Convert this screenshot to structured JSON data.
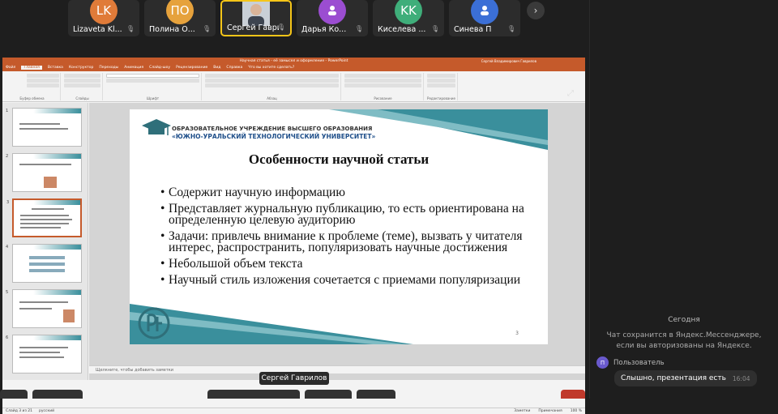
{
  "participants": [
    {
      "initials": "LK",
      "name": "Lizaveta Kl...",
      "color": "#e07b39"
    },
    {
      "initials": "ПО",
      "name": "Полина О...",
      "color": "#e6a23c"
    },
    {
      "initials": "",
      "name": "Сергей Гаври...",
      "color": "#8899aa",
      "active": true
    },
    {
      "initials": "",
      "name": "Дарья Ко...",
      "color": "#9b4dd1"
    },
    {
      "initials": "KK",
      "name": "Киселева ...",
      "color": "#3fae7a"
    },
    {
      "initials": "",
      "name": "Синева П",
      "color": "#3b6fd6"
    }
  ],
  "ppt": {
    "window_title": "Научная статья - её замысел и оформление - PowerPoint",
    "user_name": "Сергей Владимирович Гаврилов",
    "menu": [
      "Файл",
      "Главная",
      "Вставка",
      "Конструктор",
      "Переходы",
      "Анимация",
      "Слайд-шоу",
      "Рецензирование",
      "Вид",
      "Справка",
      "Что вы хотите сделать?"
    ],
    "selected_menu": "Главная",
    "ribbon_groups": [
      "Буфер обмена",
      "Слайды",
      "Шрифт",
      "Абзац",
      "Рисование",
      "Редактирование"
    ],
    "notes_placeholder": "Щелкните, чтобы добавить заметки",
    "status_left": "Слайд 3 из 21",
    "status_lang": "русский",
    "status_notes": "Заметки",
    "status_comments": "Примечания",
    "zoom": "100 %"
  },
  "slide": {
    "org_line1": "ОБРАЗОВАТЕЛЬНОЕ УЧРЕЖДЕНИЕ ВЫСШЕГО ОБРАЗОВАНИЯ",
    "org_line2": "«ЮЖНО-УРАЛЬСКИЙ ТЕХНОЛОГИЧЕСКИЙ УНИВЕРСИТЕТ»",
    "title": "Особенности научной статьи",
    "bullets": [
      "Содержит научную информацию",
      "Представляет журнальную публикацию, то есть ориентирована на определенную целевую аудиторию",
      "Задачи: привлечь внимание к проблеме (теме), вызвать у читателя интерес, распространить, популяризовать научные достижения",
      "Небольшой объем текста",
      "Научный стиль изложения сочетается с приемами популяризации"
    ],
    "page_number": "3",
    "accent": "#3a8f9c"
  },
  "speaker_label": "Сергей Гаврилов",
  "chat": {
    "date_label": "Сегодня",
    "notice": "Чат сохранится в Яндекс.Мессенджере, если вы авторизованы на Яндексе.",
    "author_initial": "П",
    "author": "Пользователь",
    "message": "Слышно, презентация есть",
    "time": "16:04"
  }
}
